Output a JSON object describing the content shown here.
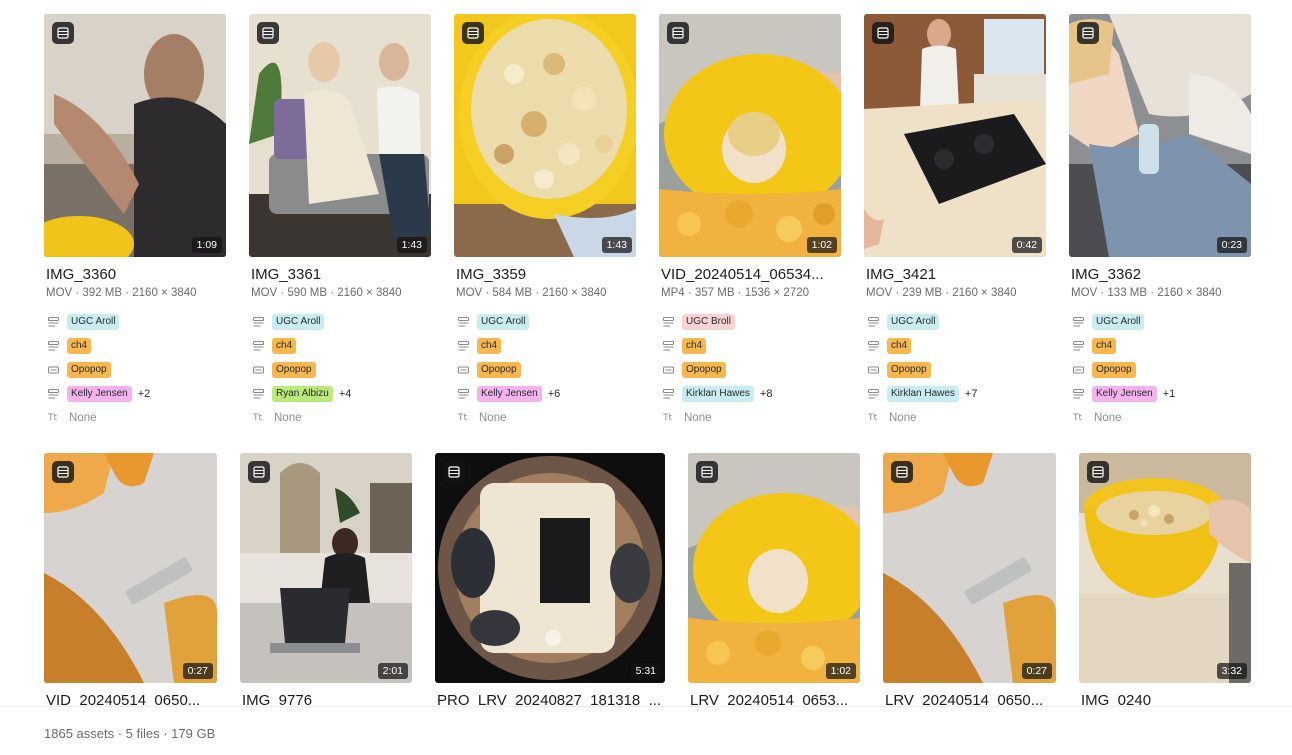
{
  "row1": [
    {
      "title": "IMG_3360",
      "meta": "MOV · 392 MB · 2160 × 3840",
      "duration": "1:09",
      "tags": {
        "type": "UGC Aroll",
        "chapter": "ch4",
        "brand": "Opopop",
        "person": "Kelly Jensen",
        "more": "+2",
        "text": "None"
      }
    },
    {
      "title": "IMG_3361",
      "meta": "MOV · 590 MB · 2160 × 3840",
      "duration": "1:43",
      "tags": {
        "type": "UGC Aroll",
        "chapter": "ch4",
        "brand": "Opopop",
        "person": "Ryan Albizu",
        "more": "+4",
        "text": "None"
      }
    },
    {
      "title": "IMG_3359",
      "meta": "MOV · 584 MB · 2160 × 3840",
      "duration": "1:43",
      "tags": {
        "type": "UGC Aroll",
        "chapter": "ch4",
        "brand": "Opopop",
        "person": "Kelly Jensen",
        "more": "+6",
        "text": "None"
      }
    },
    {
      "title": "VID_20240514_06534...",
      "meta": "MP4 · 357 MB · 1536 × 2720",
      "duration": "1:02",
      "tags": {
        "type": "UGC Broll",
        "chapter": "ch4",
        "brand": "Opopop",
        "person": "Kirklan Hawes",
        "more": "+8",
        "text": "None"
      }
    },
    {
      "title": "IMG_3421",
      "meta": "MOV · 239 MB · 2160 × 3840",
      "duration": "0:42",
      "tags": {
        "type": "UGC Aroll",
        "chapter": "ch4",
        "brand": "Opopop",
        "person": "Kirklan Hawes",
        "more": "+7",
        "text": "None"
      }
    },
    {
      "title": "IMG_3362",
      "meta": "MOV · 133 MB · 2160 × 3840",
      "duration": "0:23",
      "tags": {
        "type": "UGC Aroll",
        "chapter": "ch4",
        "brand": "Opopop",
        "person": "Kelly Jensen",
        "more": "+1",
        "text": "None"
      }
    }
  ],
  "row2": [
    {
      "title": "VID_20240514_0650...",
      "duration": "0:27"
    },
    {
      "title": "IMG_9776",
      "duration": "2:01"
    },
    {
      "title": "PRO_LRV_20240827_181318_...",
      "duration": "5:31"
    },
    {
      "title": "LRV_20240514_0653...",
      "duration": "1:02"
    },
    {
      "title": "LRV_20240514_0650...",
      "duration": "0:27"
    },
    {
      "title": "IMG_0240",
      "duration": "3:32"
    }
  ],
  "footer": {
    "status": "1865 assets · 5 files · 179 GB"
  },
  "colors": {
    "ugc_aroll": "#c9ecf2",
    "ugc_broll": "#f9d3d1",
    "chapter": "#f8b84e",
    "brand": "#f8b84e",
    "person_pink": "#f4b2ee",
    "person_green": "#b9ea7d",
    "person_blue": "#c9ecf2"
  },
  "icons": {
    "type_badge": "film-strip-icon",
    "select_property": "list-select-icon",
    "brand_property": "rectangle-select-icon",
    "text_property": "text-type-icon"
  }
}
